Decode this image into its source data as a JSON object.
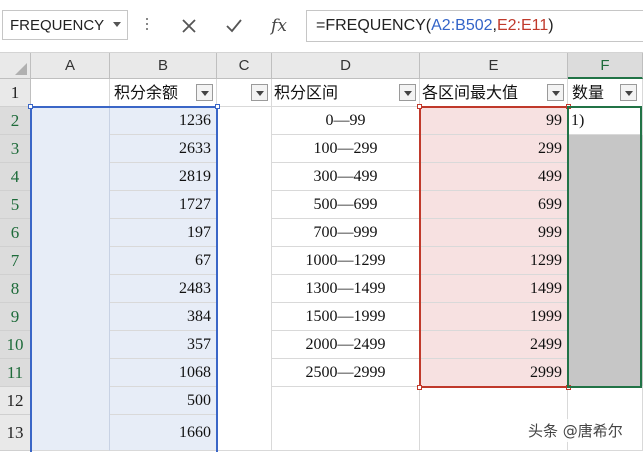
{
  "name_box": {
    "value": "FREQUENCY"
  },
  "formula_bar": {
    "cancel_icon": "close-icon",
    "enter_icon": "check-icon",
    "fx_label": "fx",
    "prefix": "=FREQUENCY(",
    "ref_data": "A2:B502",
    "separator": ",",
    "ref_bins": "E2:E11",
    "suffix": ")"
  },
  "columns": [
    "A",
    "B",
    "C",
    "D",
    "E",
    "F"
  ],
  "rows": [
    "1",
    "2",
    "3",
    "4",
    "5",
    "6",
    "7",
    "8",
    "9",
    "10",
    "11",
    "12",
    "13"
  ],
  "headers": {
    "B": "积分余额",
    "D": "积分区间",
    "E": "各区间最大值",
    "F": "数量"
  },
  "column_B": [
    "1236",
    "2633",
    "2819",
    "1727",
    "197",
    "67",
    "2483",
    "384",
    "357",
    "1068",
    "500",
    "1660"
  ],
  "column_D": [
    "0—99",
    "100—299",
    "300—499",
    "500—699",
    "700—999",
    "1000—1299",
    "1300—1499",
    "1500—1999",
    "2000—2499",
    "2500—2999"
  ],
  "column_E": [
    "99",
    "299",
    "499",
    "699",
    "999",
    "1299",
    "1499",
    "1999",
    "2499",
    "2999"
  ],
  "F2_editing": "1)",
  "colors": {
    "data_range": "#3a66c7",
    "bins_range": "#c0392b",
    "output_range": "#217346"
  },
  "watermark": "头条 @唐希尔"
}
